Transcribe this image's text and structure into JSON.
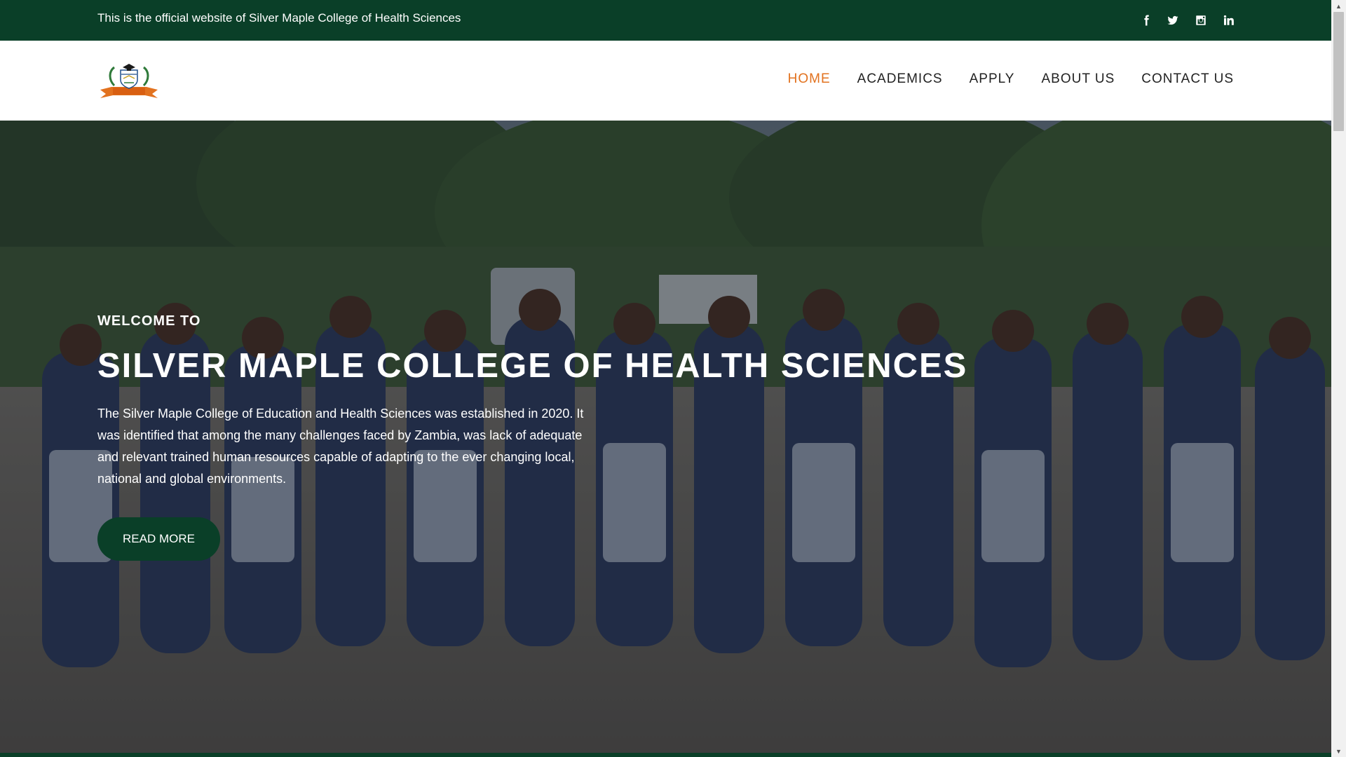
{
  "topbar": {
    "text": "This is the official website of Silver Maple College of Health Sciences",
    "social": [
      {
        "icon": "facebook-icon"
      },
      {
        "icon": "twitter-icon"
      },
      {
        "icon": "instagram-icon"
      },
      {
        "icon": "linkedin-icon"
      }
    ]
  },
  "nav": {
    "items": [
      {
        "label": "HOME",
        "active": true
      },
      {
        "label": "ACADEMICS",
        "active": false
      },
      {
        "label": "APPLY",
        "active": false
      },
      {
        "label": "ABOUT US",
        "active": false
      },
      {
        "label": "CONTACT US",
        "active": false
      }
    ]
  },
  "hero": {
    "welcome": "WELCOME TO",
    "title": "SILVER MAPLE COLLEGE OF HEALTH SCIENCES",
    "description": "The Silver Maple College of Education and Health Sciences was established in 2020. It was identified that among the many challenges faced by Zambia, was lack of adequate and relevant trained human resources capable of adapting to the ever changing local, national and global environments.",
    "button": "READ MORE"
  },
  "colors": {
    "brand_green": "#0a3f28",
    "accent_orange": "#e2721f",
    "nav_text": "#222222"
  }
}
